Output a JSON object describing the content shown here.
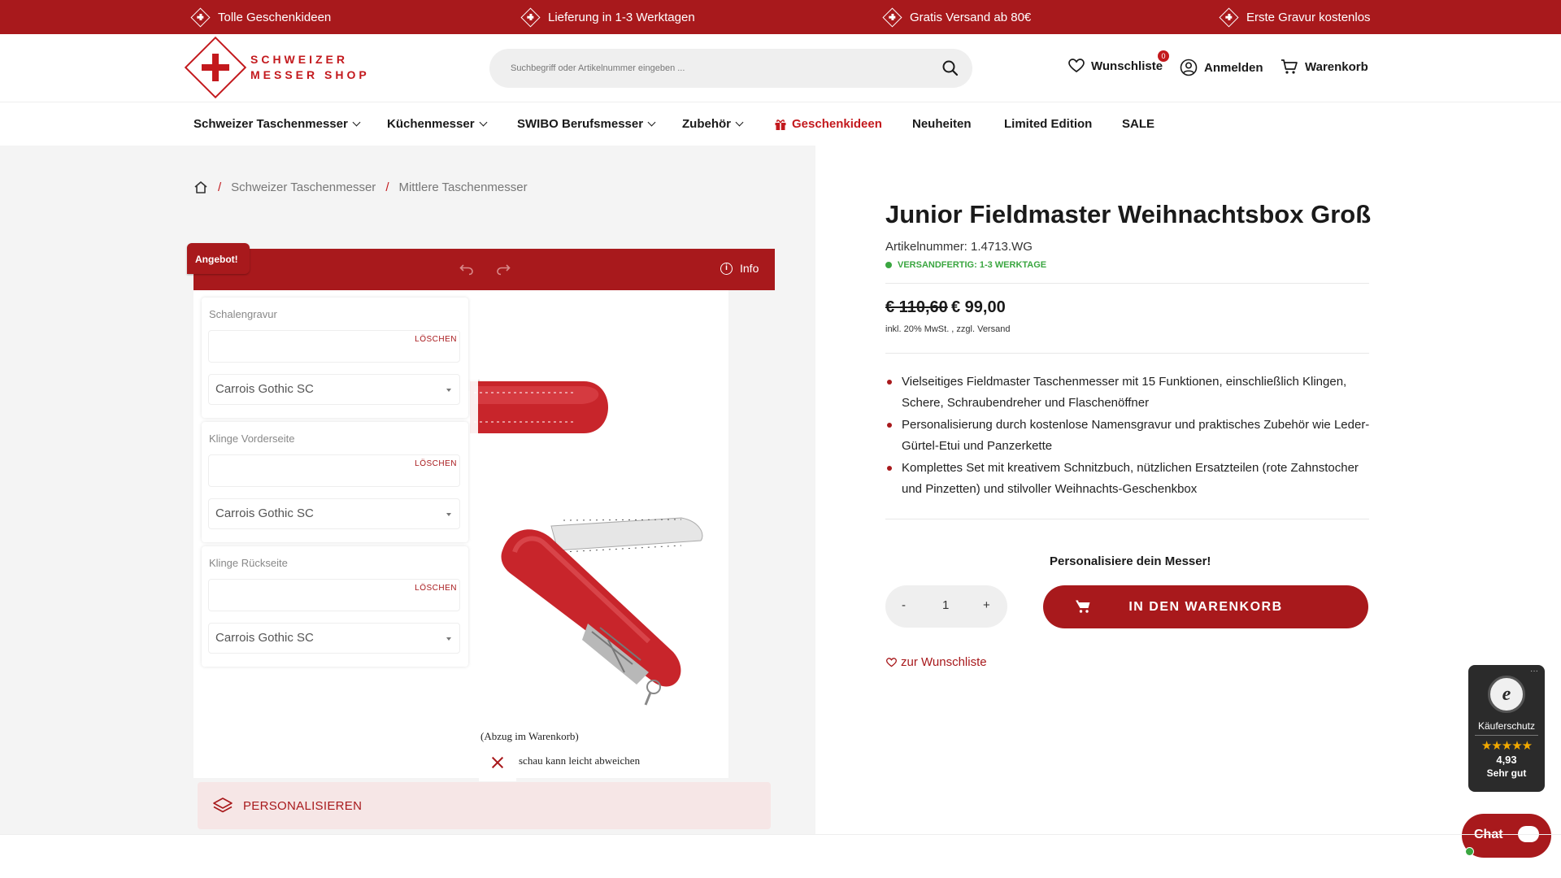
{
  "topbar": {
    "items": [
      "Tolle Geschenkideen",
      "Lieferung in 1-3 Werktagen",
      "Gratis Versand ab 80€",
      "Erste Gravur kostenlos"
    ]
  },
  "header": {
    "logo_line1": "SCHWEIZER",
    "logo_line2": "MESSER SHOP",
    "search_placeholder": "Suchbegriff oder Artikelnummer eingeben ...",
    "wishlist_label": "Wunschliste",
    "wishlist_count": "0",
    "login_label": "Anmelden",
    "cart_label": "Warenkorb"
  },
  "nav": {
    "items": [
      "Schweizer Taschenmesser",
      "Küchenmesser",
      "SWIBO Berufsmesser",
      "Zubehör",
      "Geschenkideen",
      "Neuheiten",
      "Limited Edition",
      "SALE"
    ]
  },
  "breadcrumb": {
    "items": [
      "Schweizer Taschenmesser",
      "Mittlere Taschenmesser"
    ]
  },
  "editor": {
    "badge": "Angebot!",
    "info_label": "Info",
    "groups": [
      {
        "label": "Schalengravur",
        "delete_label": "LÖSCHEN",
        "font_value": "Carrois Gothic SC"
      },
      {
        "label": "Klinge Vorderseite",
        "delete_label": "LÖSCHEN",
        "font_value": "Carrois Gothic SC"
      },
      {
        "label": "Klinge Rückseite",
        "delete_label": "LÖSCHEN",
        "font_value": "Carrois Gothic SC"
      }
    ],
    "note1": "(Abzug im Warenkorb)",
    "note2": "schau kann leicht abweichen",
    "personalize_label": "PERSONALISIEREN"
  },
  "product": {
    "title": "Junior Fieldmaster Weihnachtsbox Groß",
    "article_number": "Artikelnummer: 1.4713.WG",
    "stock_status": "VERSANDFERTIG: 1-3 WERKTAGE",
    "price_old": "€ 110,60",
    "price_new": "€ 99,00",
    "vat_note": "inkl. 20% MwSt. , zzgl. Versand",
    "bullets": [
      "Vielseitiges Fieldmaster Taschenmesser mit 15 Funktionen, einschließlich Klingen, Schere, Schraubendreher und Flaschenöffner",
      "Personalisierung durch kostenlose Namensgravur und praktisches Zubehör wie Leder-Gürtel-Etui und Panzerkette",
      "Komplettes Set mit kreativem Schnitzbuch, nützlichen Ersatzteilen (rote Zahnstocher und Pinzetten) und stilvoller Weihnachts-Geschenkbox"
    ],
    "personalize_prompt": "Personalisiere dein Messer!",
    "qty_minus": "-",
    "qty_value": "1",
    "qty_plus": "+",
    "add_to_cart": "IN DEN WARENKORB",
    "wishlist_link": "zur Wunschliste"
  },
  "trust_badge": {
    "label": "Käuferschutz",
    "stars": "★★★★★",
    "score": "4,93",
    "rating": "Sehr gut"
  },
  "chat": {
    "label": "Chat"
  },
  "colors": {
    "brand_red": "#a8191c",
    "stock_green": "#3aa640",
    "star_gold": "#f2a900"
  }
}
